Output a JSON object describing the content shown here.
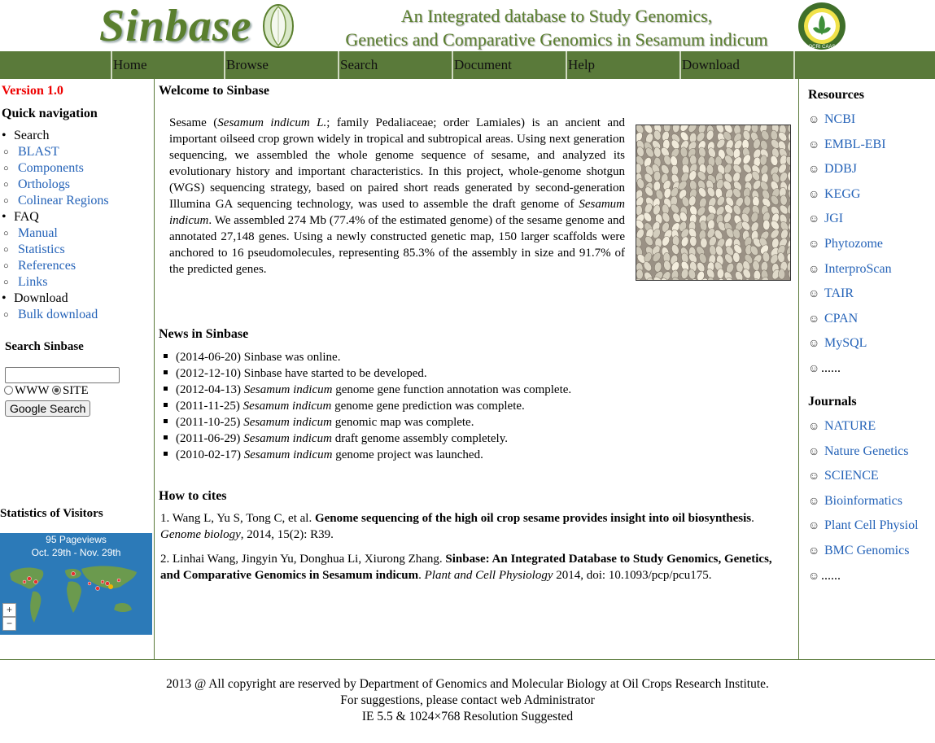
{
  "header": {
    "logo_text": "Sinbase",
    "tagline_line1": "An Integrated database to Study Genomics,",
    "tagline_line2": "Genetics and Comparative Genomics in Sesamum indicum",
    "emblem_text": "OCRI  CAAS"
  },
  "nav": [
    "Home",
    "Browse",
    "Search",
    "Document",
    "Help",
    "Download"
  ],
  "left": {
    "version": "Version 1.0",
    "quick_nav_title": "Quick navigation",
    "groups": [
      {
        "label": "Search",
        "items": [
          "BLAST",
          "Components",
          "Orthologs",
          "Colinear Regions"
        ]
      },
      {
        "label": "FAQ",
        "items": [
          "Manual",
          "Statistics",
          "References",
          "Links"
        ]
      },
      {
        "label": "Download",
        "items": [
          "Bulk download"
        ]
      }
    ],
    "search_title": "Search Sinbase",
    "radio_www": "WWW",
    "radio_site": "SITE",
    "search_button": "Google Search",
    "stats_title": "Statistics of Visitors",
    "pageviews": "95 Pageviews",
    "date_range": "Oct. 29th - Nov. 29th"
  },
  "main": {
    "welcome_title": "Welcome to Sinbase",
    "intro": {
      "p1": "Sesame (",
      "p2": "Sesamum indicum L.",
      "p3": "; family Pedaliaceae; order Lamiales) is an ancient and important oilseed crop grown widely in tropical and subtropical areas. Using next generation sequencing, we assembled the whole genome sequence of sesame, and analyzed its evolutionary history and important characteristics. In this project, whole-genome shotgun (WGS) sequencing strategy, based on paired short reads generated by second-generation Illumina GA sequencing technology, was used to assemble the draft genome of ",
      "p4": "Sesamum indicum",
      "p5": ". We assembled 274 Mb (77.4% of the estimated genome) of the sesame genome and annotated 27,148 genes. Using a newly constructed genetic map, 150 larger scaffolds were anchored to 16 pseudomolecules, representing 85.3% of the assembly in size and 91.7% of the predicted genes."
    },
    "news_title": "News in Sinbase",
    "news": [
      {
        "date": "(2014-06-20)",
        "italic": "",
        "text": " Sinbase was online."
      },
      {
        "date": "(2012-12-10)",
        "italic": "",
        "text": " Sinbase have started to be developed."
      },
      {
        "date": "(2012-04-13)",
        "italic": " Sesamum indicum",
        "text": " genome gene function annotation was complete."
      },
      {
        "date": "(2011-11-25)",
        "italic": " Sesamum indicum",
        "text": " genome gene prediction was complete."
      },
      {
        "date": "(2011-10-25)",
        "italic": " Sesamum indicum",
        "text": " genomic map was complete."
      },
      {
        "date": "(2011-06-29)",
        "italic": " Sesamum indicum",
        "text": " draft genome assembly completely."
      },
      {
        "date": "(2010-02-17)",
        "italic": " Sesamum indicum",
        "text": " genome project was launched."
      }
    ],
    "cites_title": "How to cites",
    "cite1": {
      "authors": "1. Wang L, Yu S, Tong C, et al. ",
      "title": "Genome sequencing of the high oil crop sesame provides insight into oil biosynthesis",
      "sep": ". ",
      "journal": "Genome biology",
      "rest": ", 2014, 15(2): R39."
    },
    "cite2": {
      "authors": "2. Linhai Wang, Jingyin Yu, Donghua Li, Xiurong Zhang. ",
      "title": "Sinbase: An Integrated Database to Study Genomics, Genetics, and Comparative Genomics in Sesamum indicum",
      "sep": ". ",
      "journal": "Plant and Cell Physiology",
      "rest": " 2014, doi: 10.1093/pcp/pcu175."
    }
  },
  "right": {
    "resources_title": "Resources",
    "resources": [
      "NCBI",
      "EMBL-EBI",
      "DDBJ",
      "KEGG",
      "JGI",
      "Phytozome",
      "InterproScan",
      "TAIR",
      "CPAN",
      "MySQL",
      "......"
    ],
    "journals_title": "Journals",
    "journals": [
      "NATURE",
      "Nature Genetics",
      "SCIENCE",
      "Bioinformatics",
      "Plant Cell  Physiol",
      "BMC Genomics",
      "......"
    ],
    "smiley": "☺"
  },
  "footer": {
    "line1": "2013 @ All copyright are reserved by Department of Genomics and Molecular Biology at Oil Crops Research Institute.",
    "line2": "For suggestions, please contact web Administrator",
    "line3": "IE 5.5 & 1024×768 Resolution Suggested"
  },
  "colors": {
    "nav_green": "#5a7a3a",
    "logo_green": "#5a7f2e",
    "link_blue": "#2563b8",
    "version_red": "#e00000",
    "map_blue": "#2c7ab8"
  }
}
